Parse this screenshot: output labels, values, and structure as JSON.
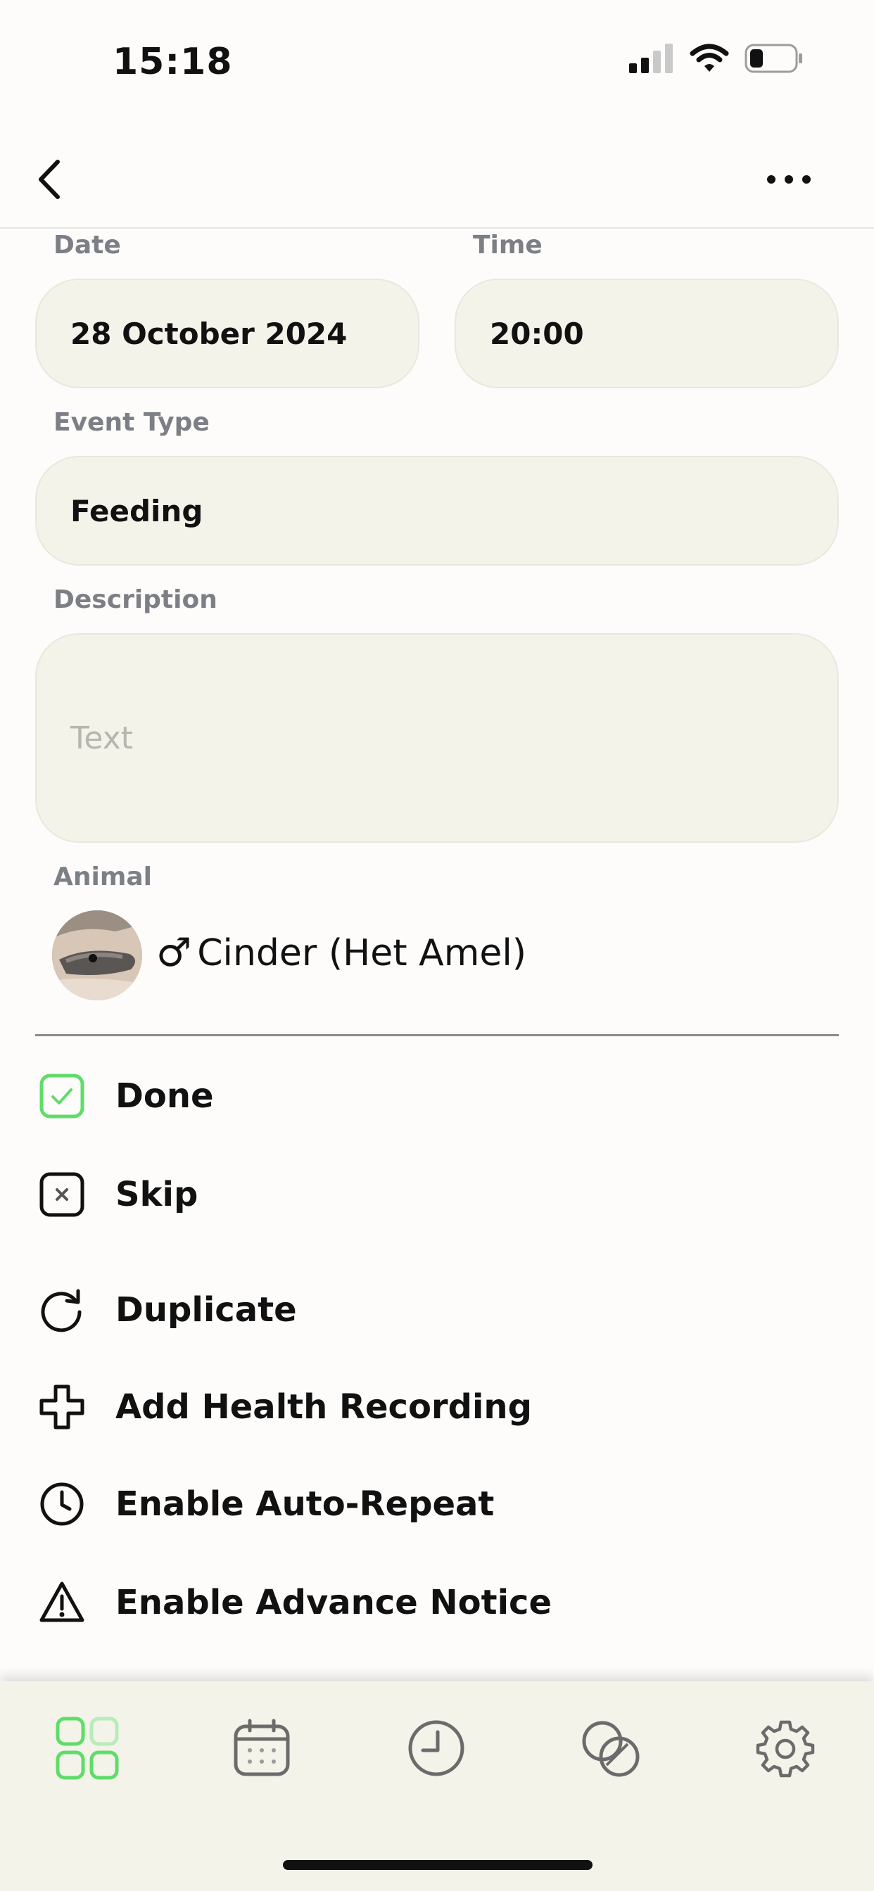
{
  "status_bar": {
    "time": "15:18"
  },
  "form": {
    "date_label": "Date",
    "date_value": "28 October 2024",
    "time_label": "Time",
    "time_value": "20:00",
    "event_type_label": "Event Type",
    "event_type_value": "Feeding",
    "description_label": "Description",
    "description_placeholder": "Text",
    "animal_label": "Animal",
    "animal_sex_symbol": "♂",
    "animal_name": "Cinder (Het Amel)"
  },
  "actions": [
    {
      "label": "Done",
      "icon": "checkbox-checked-icon"
    },
    {
      "label": "Skip",
      "icon": "checkbox-x-icon"
    },
    {
      "label": "Duplicate",
      "icon": "refresh-icon"
    },
    {
      "label": "Add Health Recording",
      "icon": "plus-outline-icon"
    },
    {
      "label": "Enable Auto-Repeat",
      "icon": "clock-icon"
    },
    {
      "label": "Enable Advance Notice",
      "icon": "warning-icon"
    }
  ],
  "tabbar": {
    "items": [
      {
        "icon": "grid-icon",
        "active": true
      },
      {
        "icon": "calendar-icon",
        "active": false
      },
      {
        "icon": "clock-icon",
        "active": false
      },
      {
        "icon": "overlap-circles-icon",
        "active": false
      },
      {
        "icon": "gear-icon",
        "active": false
      }
    ]
  },
  "colors": {
    "accent": "#5fdc6a",
    "field_bg": "#f4f3ea",
    "label": "#7d7f86",
    "placeholder": "#b6b6b0"
  }
}
